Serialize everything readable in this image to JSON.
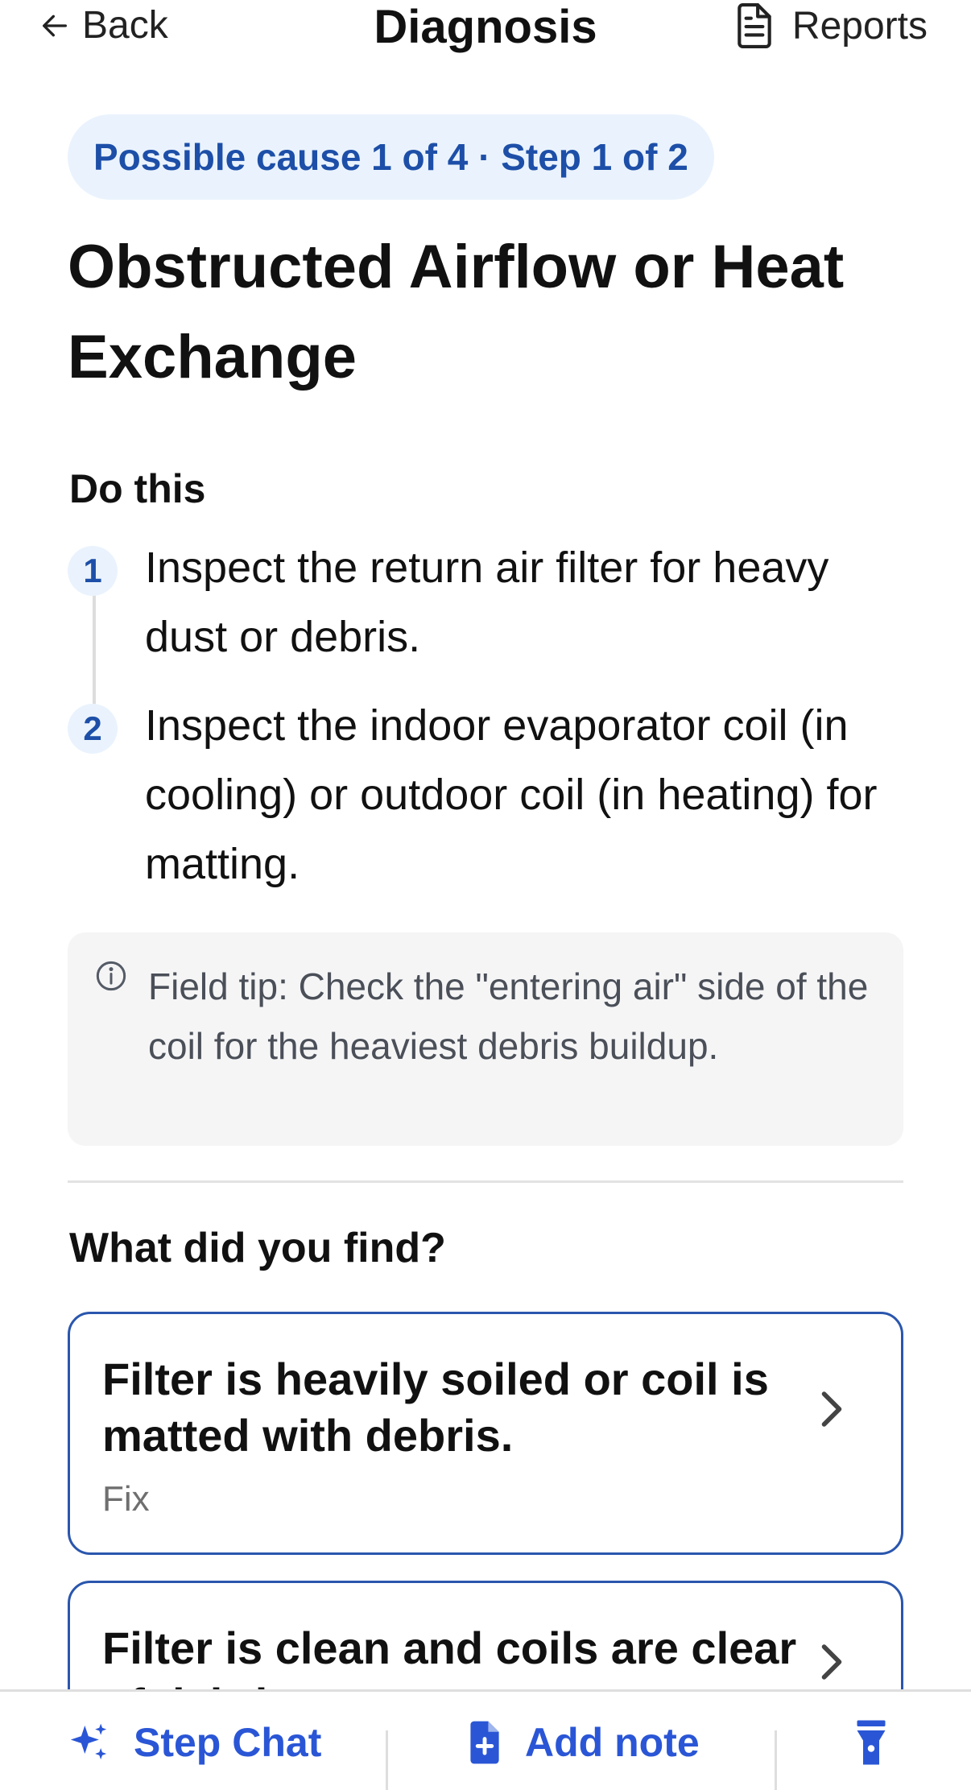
{
  "header": {
    "back_label": "Back",
    "title": "Diagnosis",
    "reports_label": "Reports"
  },
  "progress": {
    "label": "Possible cause 1 of 4 · Step 1 of 2"
  },
  "cause": {
    "title": "Obstructed Airflow or Heat Exchange"
  },
  "instructions": {
    "label": "Do this",
    "steps": [
      {
        "number": "1",
        "text": "Inspect the return air filter for heavy dust or debris."
      },
      {
        "number": "2",
        "text": "Inspect the indoor evaporator coil (in cooling) or outdoor coil (in heating) for matting."
      }
    ]
  },
  "tip": {
    "text": "Field tip: Check the \"entering air\" side of the coil for the heaviest debris buildup."
  },
  "findings": {
    "question": "What did you find?",
    "options": [
      {
        "title": "Filter is heavily soiled or coil is matted with debris.",
        "subtitle": "Fix"
      },
      {
        "title": "Filter is clean and coils are clear of debris."
      }
    ]
  },
  "bottom_bar": {
    "step_chat_label": "Step Chat",
    "add_note_label": "Add note"
  },
  "colors": {
    "accent": "#2a56d6",
    "pill_bg": "#eaf3fd",
    "pill_text": "#1d4fa8",
    "card_border": "#2a56ad",
    "tip_bg": "#f5f5f6"
  },
  "icons": {
    "back": "arrow-left-icon",
    "reports": "document-icon",
    "tip": "info-icon",
    "option": "chevron-right-icon",
    "step_chat": "sparkles-icon",
    "add_note": "file-plus-icon",
    "more": "flashlight-icon"
  }
}
